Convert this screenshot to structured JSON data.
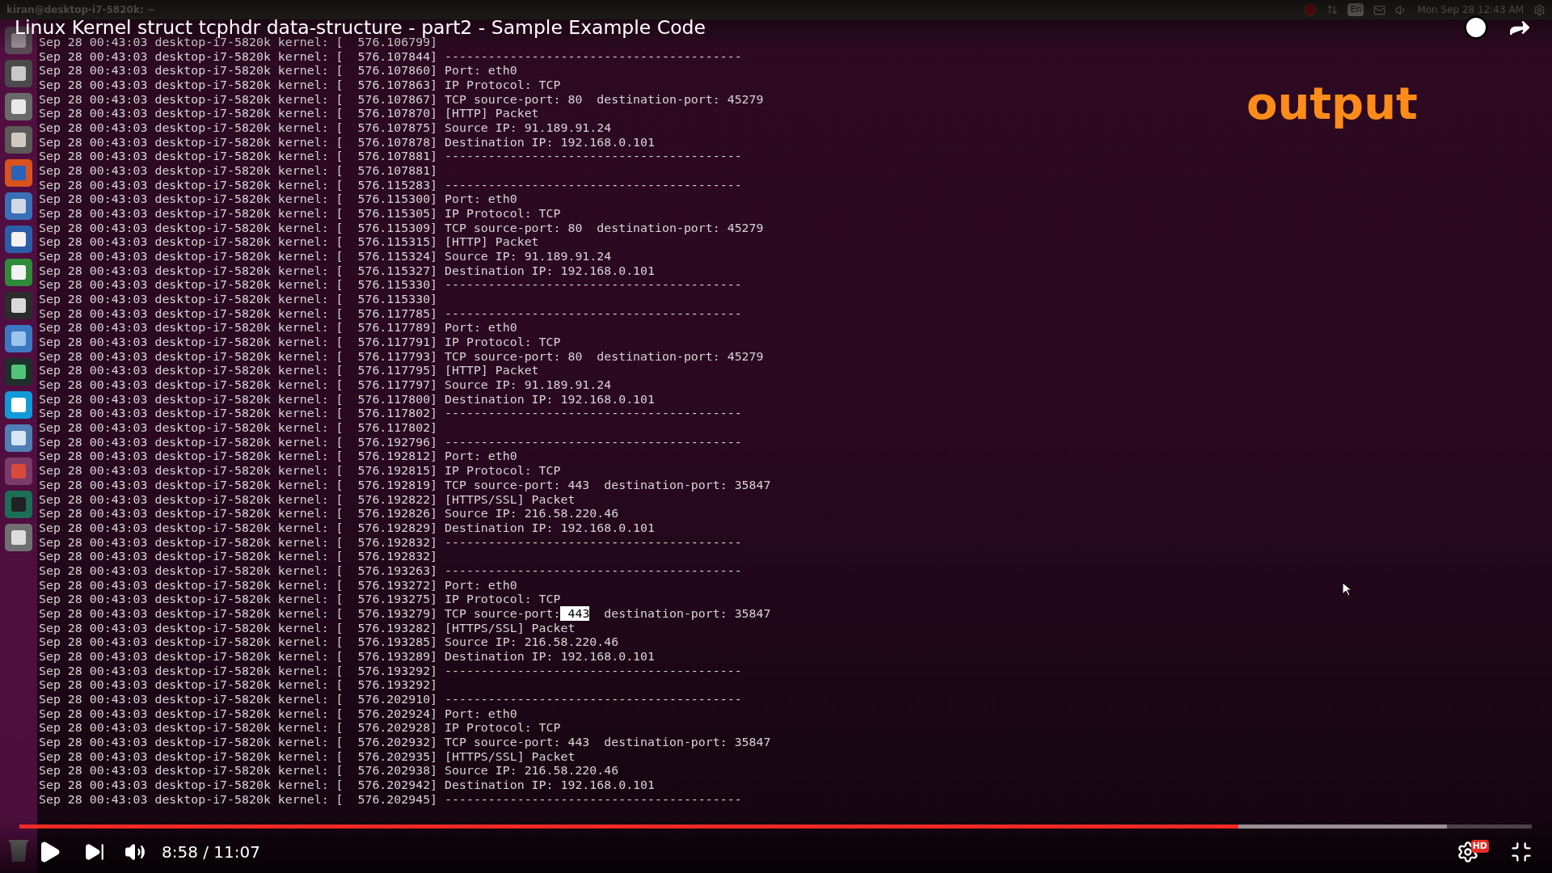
{
  "panel": {
    "window_title": "kiran@desktop-i7-5820k: ~",
    "keyboard": "En",
    "clock": "Mon Sep 28 12:43 AM"
  },
  "video": {
    "title": "Linux Kernel struct tcphdr data-structure - part2 - Sample Example Code",
    "caption": "output"
  },
  "terminal": {
    "lines": [
      {
        "text": "Sep 28 00:43:03 desktop-i7-5820k kernel: [  576.106799]"
      },
      {
        "text": "Sep 28 00:43:03 desktop-i7-5820k kernel: [  576.107844] -----------------------------------------"
      },
      {
        "text": "Sep 28 00:43:03 desktop-i7-5820k kernel: [  576.107860] Port: eth0"
      },
      {
        "text": "Sep 28 00:43:03 desktop-i7-5820k kernel: [  576.107863] IP Protocol: TCP"
      },
      {
        "text": "Sep 28 00:43:03 desktop-i7-5820k kernel: [  576.107867] TCP source-port: 80  destination-port: 45279"
      },
      {
        "text": "Sep 28 00:43:03 desktop-i7-5820k kernel: [  576.107870] [HTTP] Packet"
      },
      {
        "text": "Sep 28 00:43:03 desktop-i7-5820k kernel: [  576.107875] Source IP: 91.189.91.24"
      },
      {
        "text": "Sep 28 00:43:03 desktop-i7-5820k kernel: [  576.107878] Destination IP: 192.168.0.101"
      },
      {
        "text": "Sep 28 00:43:03 desktop-i7-5820k kernel: [  576.107881] -----------------------------------------"
      },
      {
        "text": "Sep 28 00:43:03 desktop-i7-5820k kernel: [  576.107881]"
      },
      {
        "text": "Sep 28 00:43:03 desktop-i7-5820k kernel: [  576.115283] -----------------------------------------"
      },
      {
        "text": "Sep 28 00:43:03 desktop-i7-5820k kernel: [  576.115300] Port: eth0"
      },
      {
        "text": "Sep 28 00:43:03 desktop-i7-5820k kernel: [  576.115305] IP Protocol: TCP"
      },
      {
        "text": "Sep 28 00:43:03 desktop-i7-5820k kernel: [  576.115309] TCP source-port: 80  destination-port: 45279"
      },
      {
        "text": "Sep 28 00:43:03 desktop-i7-5820k kernel: [  576.115315] [HTTP] Packet"
      },
      {
        "text": "Sep 28 00:43:03 desktop-i7-5820k kernel: [  576.115324] Source IP: 91.189.91.24"
      },
      {
        "text": "Sep 28 00:43:03 desktop-i7-5820k kernel: [  576.115327] Destination IP: 192.168.0.101"
      },
      {
        "text": "Sep 28 00:43:03 desktop-i7-5820k kernel: [  576.115330] -----------------------------------------"
      },
      {
        "text": "Sep 28 00:43:03 desktop-i7-5820k kernel: [  576.115330]"
      },
      {
        "text": "Sep 28 00:43:03 desktop-i7-5820k kernel: [  576.117785] -----------------------------------------"
      },
      {
        "text": "Sep 28 00:43:03 desktop-i7-5820k kernel: [  576.117789] Port: eth0"
      },
      {
        "text": "Sep 28 00:43:03 desktop-i7-5820k kernel: [  576.117791] IP Protocol: TCP"
      },
      {
        "text": "Sep 28 00:43:03 desktop-i7-5820k kernel: [  576.117793] TCP source-port: 80  destination-port: 45279"
      },
      {
        "text": "Sep 28 00:43:03 desktop-i7-5820k kernel: [  576.117795] [HTTP] Packet"
      },
      {
        "text": "Sep 28 00:43:03 desktop-i7-5820k kernel: [  576.117797] Source IP: 91.189.91.24"
      },
      {
        "text": "Sep 28 00:43:03 desktop-i7-5820k kernel: [  576.117800] Destination IP: 192.168.0.101"
      },
      {
        "text": "Sep 28 00:43:03 desktop-i7-5820k kernel: [  576.117802] -----------------------------------------"
      },
      {
        "text": "Sep 28 00:43:03 desktop-i7-5820k kernel: [  576.117802]"
      },
      {
        "text": "Sep 28 00:43:03 desktop-i7-5820k kernel: [  576.192796] -----------------------------------------"
      },
      {
        "text": "Sep 28 00:43:03 desktop-i7-5820k kernel: [  576.192812] Port: eth0"
      },
      {
        "text": "Sep 28 00:43:03 desktop-i7-5820k kernel: [  576.192815] IP Protocol: TCP"
      },
      {
        "text": "Sep 28 00:43:03 desktop-i7-5820k kernel: [  576.192819] TCP source-port: 443  destination-port: 35847"
      },
      {
        "text": "Sep 28 00:43:03 desktop-i7-5820k kernel: [  576.192822] [HTTPS/SSL] Packet"
      },
      {
        "text": "Sep 28 00:43:03 desktop-i7-5820k kernel: [  576.192826] Source IP: 216.58.220.46"
      },
      {
        "text": "Sep 28 00:43:03 desktop-i7-5820k kernel: [  576.192829] Destination IP: 192.168.0.101"
      },
      {
        "text": "Sep 28 00:43:03 desktop-i7-5820k kernel: [  576.192832] -----------------------------------------"
      },
      {
        "text": "Sep 28 00:43:03 desktop-i7-5820k kernel: [  576.192832]"
      },
      {
        "text": "Sep 28 00:43:03 desktop-i7-5820k kernel: [  576.193263] -----------------------------------------"
      },
      {
        "text": "Sep 28 00:43:03 desktop-i7-5820k kernel: [  576.193272] Port: eth0"
      },
      {
        "text": "Sep 28 00:43:03 desktop-i7-5820k kernel: [  576.193275] IP Protocol: TCP"
      },
      {
        "text": "Sep 28 00:43:03 desktop-i7-5820k kernel: [  576.193279] TCP source-port:",
        "selection": " 443",
        "after": "  destination-port: 35847"
      },
      {
        "text": "Sep 28 00:43:03 desktop-i7-5820k kernel: [  576.193282] [HTTPS/SSL] Packet"
      },
      {
        "text": "Sep 28 00:43:03 desktop-i7-5820k kernel: [  576.193285] Source IP: 216.58.220.46"
      },
      {
        "text": "Sep 28 00:43:03 desktop-i7-5820k kernel: [  576.193289] Destination IP: 192.168.0.101"
      },
      {
        "text": "Sep 28 00:43:03 desktop-i7-5820k kernel: [  576.193292] -----------------------------------------"
      },
      {
        "text": "Sep 28 00:43:03 desktop-i7-5820k kernel: [  576.193292]"
      },
      {
        "text": "Sep 28 00:43:03 desktop-i7-5820k kernel: [  576.202910] -----------------------------------------"
      },
      {
        "text": "Sep 28 00:43:03 desktop-i7-5820k kernel: [  576.202924] Port: eth0"
      },
      {
        "text": "Sep 28 00:43:03 desktop-i7-5820k kernel: [  576.202928] IP Protocol: TCP"
      },
      {
        "text": "Sep 28 00:43:03 desktop-i7-5820k kernel: [  576.202932] TCP source-port: 443  destination-port: 35847"
      },
      {
        "text": "Sep 28 00:43:03 desktop-i7-5820k kernel: [  576.202935] [HTTPS/SSL] Packet"
      },
      {
        "text": "Sep 28 00:43:03 desktop-i7-5820k kernel: [  576.202938] Source IP: 216.58.220.46"
      },
      {
        "text": "Sep 28 00:43:03 desktop-i7-5820k kernel: [  576.202942] Destination IP: 192.168.0.101"
      },
      {
        "text": "Sep 28 00:43:03 desktop-i7-5820k kernel: [  576.202945] -----------------------------------------"
      }
    ]
  },
  "player": {
    "played": {
      "level": 0.806
    },
    "buffered": {
      "level": 0.944
    },
    "time": "8:58 / 11:07",
    "quality_badge": "HD"
  }
}
